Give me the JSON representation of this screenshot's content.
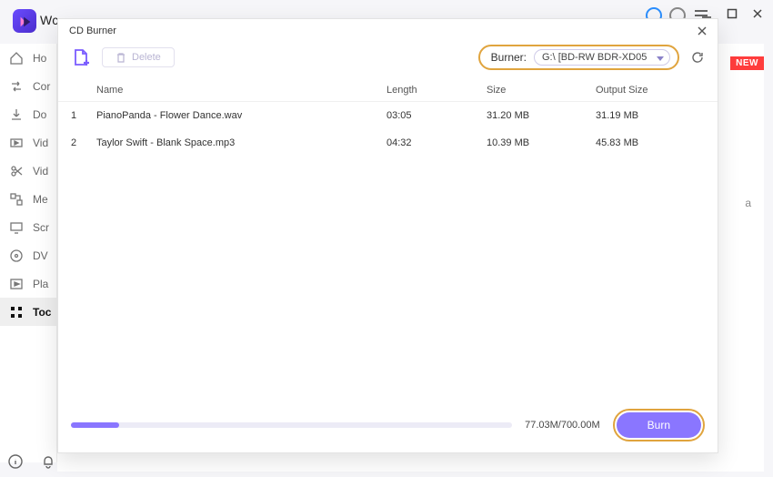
{
  "app_title_fragment": "Wc",
  "window_controls": {
    "minimize": "—",
    "maximize": "▢",
    "close": "✕"
  },
  "sidebar": {
    "items": [
      {
        "label": "Ho"
      },
      {
        "label": "Cor"
      },
      {
        "label": "Do"
      },
      {
        "label": "Vid"
      },
      {
        "label": "Vid"
      },
      {
        "label": "Me"
      },
      {
        "label": "Scr"
      },
      {
        "label": "DV"
      },
      {
        "label": "Pla"
      },
      {
        "label": "Toc",
        "active": true
      }
    ]
  },
  "badge_new": "NEW",
  "media_hint_char": "a",
  "modal": {
    "title": "CD Burner",
    "delete_label": "Delete",
    "burner_label": "Burner:",
    "burner_value": "G:\\ [BD-RW   BDR-XD05",
    "columns": {
      "name": "Name",
      "length": "Length",
      "size": "Size",
      "output": "Output Size"
    },
    "rows": [
      {
        "idx": "1",
        "name": "PianoPanda - Flower Dance.wav",
        "length": "03:05",
        "size": "31.20 MB",
        "output": "31.19 MB"
      },
      {
        "idx": "2",
        "name": "Taylor Swift - Blank Space.mp3",
        "length": "04:32",
        "size": "10.39 MB",
        "output": "45.83 MB"
      }
    ],
    "progress_text": "77.03M/700.00M",
    "burn_label": "Burn"
  }
}
